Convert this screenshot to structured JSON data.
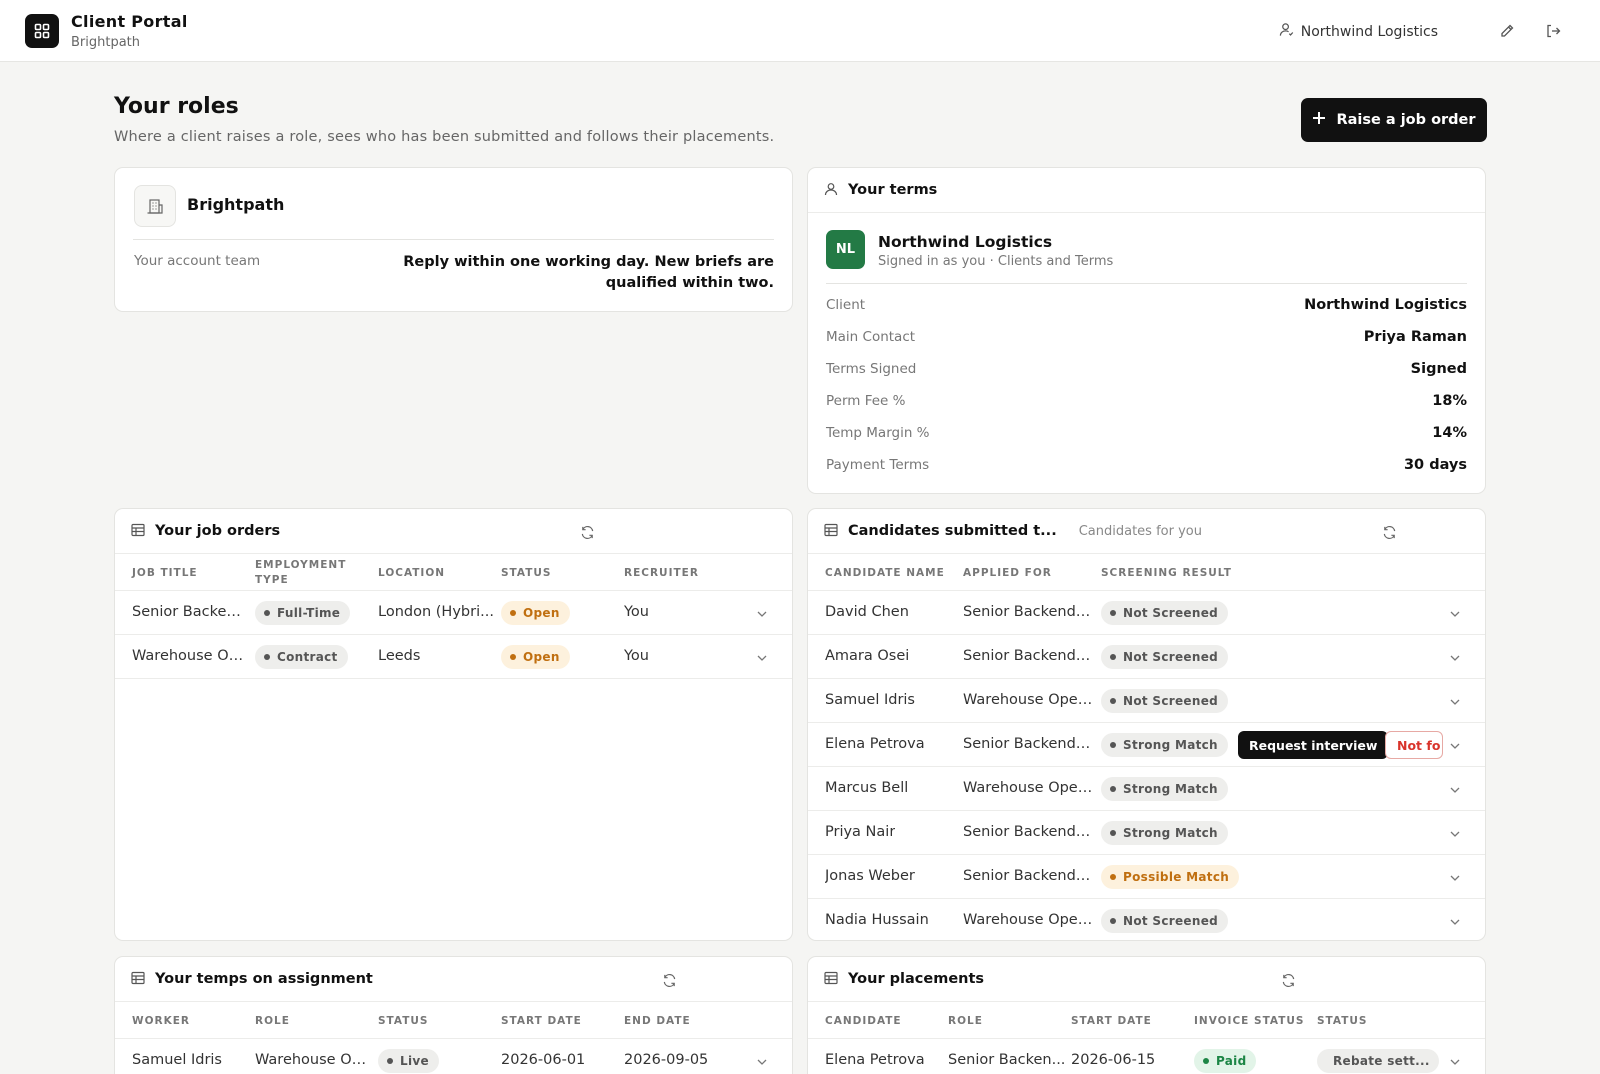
{
  "header": {
    "app_title": "Client Portal",
    "app_subtitle": "Brightpath",
    "user_name": "Northwind Logistics"
  },
  "page": {
    "title": "Your roles",
    "subtitle": "Where a client raises a role, sees who has been submitted and follows their placements.",
    "primary_button": "Raise a job order"
  },
  "account_card": {
    "name": "Brightpath",
    "label": "Your account team",
    "note": "Reply within one working day. New briefs are qualified within two."
  },
  "terms_card": {
    "title": "Your terms",
    "avatar_initials": "NL",
    "avatar_color": "#237a45",
    "company": "Northwind Logistics",
    "signed_in": "Signed in as you · Clients and Terms",
    "fields": [
      {
        "label": "Client",
        "value": "Northwind Logistics"
      },
      {
        "label": "Main Contact",
        "value": "Priya Raman"
      },
      {
        "label": "Terms Signed",
        "value": "Signed"
      },
      {
        "label": "Perm Fee %",
        "value": "18%"
      },
      {
        "label": "Temp Margin %",
        "value": "14%"
      },
      {
        "label": "Payment Terms",
        "value": "30 days"
      }
    ]
  },
  "job_orders": {
    "title": "Your job orders",
    "columns": [
      "Job Title",
      "Employment Type",
      "Location",
      "Status",
      "Recruiter"
    ],
    "rows": [
      {
        "title": "Senior Backen...",
        "type": "Full-Time",
        "location": "London (Hybri...",
        "status": "Open",
        "recruiter": "You"
      },
      {
        "title": "Warehouse Op...",
        "type": "Contract",
        "location": "Leeds",
        "status": "Open",
        "recruiter": "You"
      }
    ]
  },
  "candidates": {
    "title": "Candidates submitted t...",
    "hint": "Candidates for you",
    "columns": [
      "Candidate Name",
      "Applied For",
      "Screening Result"
    ],
    "rows": [
      {
        "name": "David Chen",
        "applied": "Senior Backend ...",
        "result": "Not Screened"
      },
      {
        "name": "Amara Osei",
        "applied": "Senior Backend ...",
        "result": "Not Screened"
      },
      {
        "name": "Samuel Idris",
        "applied": "Warehouse Oper...",
        "result": "Not Screened"
      },
      {
        "name": "Elena Petrova",
        "applied": "Senior Backend ...",
        "result": "Strong Match"
      },
      {
        "name": "Marcus Bell",
        "applied": "Warehouse Oper...",
        "result": "Strong Match"
      },
      {
        "name": "Priya Nair",
        "applied": "Senior Backend ...",
        "result": "Strong Match"
      },
      {
        "name": "Jonas Weber",
        "applied": "Senior Backend ...",
        "result": "Possible Match"
      },
      {
        "name": "Nadia Hussain",
        "applied": "Warehouse Oper...",
        "result": "Not Screened"
      }
    ],
    "actions": {
      "request": "Request interview",
      "reject": "Not fo"
    }
  },
  "temps": {
    "title": "Your temps on assignment",
    "columns": [
      "Worker",
      "Role",
      "Status",
      "Start Date",
      "End Date"
    ],
    "rows": [
      {
        "worker": "Samuel Idris",
        "role": "Warehouse Op...",
        "status": "Live",
        "start": "2026-06-01",
        "end": "2026-09-05"
      }
    ]
  },
  "placements": {
    "title": "Your placements",
    "columns": [
      "Candidate",
      "Role",
      "Start Date",
      "Invoice Status",
      "Status"
    ],
    "rows": [
      {
        "candidate": "Elena Petrova",
        "role": "Senior Backen...",
        "start": "2026-06-15",
        "invoice": "Paid",
        "status": "Rebate sett..."
      }
    ]
  }
}
